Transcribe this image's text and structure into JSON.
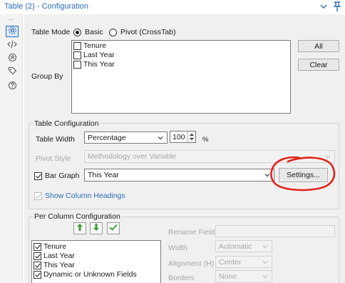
{
  "window": {
    "title": "Table (2) - Configuration"
  },
  "sidebar": {
    "items": [
      {
        "icon": "gear-icon"
      },
      {
        "icon": "code-icon"
      },
      {
        "icon": "connection-icon"
      },
      {
        "icon": "tag-icon"
      },
      {
        "icon": "help-icon"
      }
    ]
  },
  "table_mode": {
    "label": "Table Mode",
    "basic_label": "Basic",
    "pivot_label": "Pivot (CrossTab)",
    "selected": "Basic"
  },
  "group_by": {
    "label": "Group By",
    "fields": [
      "Tenure",
      "Last Year",
      "This Year"
    ],
    "all_label": "All",
    "clear_label": "Clear"
  },
  "table_config": {
    "title": "Table Configuration",
    "width_label": "Table Width",
    "width_mode": "Percentage",
    "width_value": "100",
    "width_unit": "%",
    "pivot_style_label": "Pivot Style",
    "pivot_style_value": "Methodology over Variable",
    "bar_graph_label": "Bar Graph",
    "bar_graph_value": "This Year",
    "settings_label": "Settings...",
    "show_headings_label": "Show Column Headings"
  },
  "per_column": {
    "title": "Per Column Configuration",
    "columns": [
      "Tenure",
      "Last Year",
      "This Year",
      "Dynamic or Unknown Fields"
    ],
    "rename_label": "Rename Field",
    "width_label": "Width",
    "width_value": "Automatic",
    "alignment_label": "Alignment (H)",
    "alignment_value": "Center",
    "borders_label": "Borders",
    "borders_value": "None"
  },
  "colors": {
    "accent": "#2a6ebb",
    "annotation": "#e0241b",
    "move_arrows": "#3a9a3a"
  }
}
